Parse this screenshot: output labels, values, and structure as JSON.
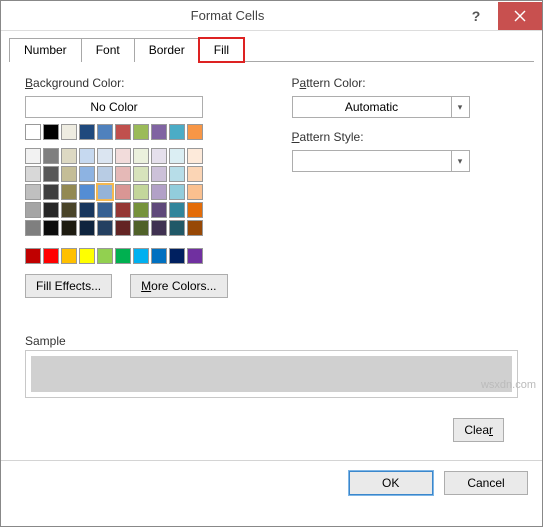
{
  "window": {
    "title": "Format Cells"
  },
  "tabs": {
    "number": "Number",
    "font": "Font",
    "border": "Border",
    "fill": "Fill"
  },
  "fill": {
    "bg_label": "Background Color:",
    "no_color": "No Color",
    "pattern_color_label": "Pattern Color:",
    "pattern_color_value": "Automatic",
    "pattern_style_label": "Pattern Style:",
    "pattern_style_value": "",
    "fill_effects": "Fill Effects...",
    "more_colors": "More Colors...",
    "sample_label": "Sample",
    "clear": "Clear"
  },
  "footer": {
    "ok": "OK",
    "cancel": "Cancel"
  },
  "swatches": {
    "row0": [
      "#ffffff",
      "#000000",
      "#eeece1",
      "#1f497d",
      "#4f81bd",
      "#c0504d",
      "#9bbb59",
      "#8064a2",
      "#4bacc6",
      "#f79646"
    ],
    "row1": [
      "#f2f2f2",
      "#7f7f7f",
      "#ddd9c3",
      "#c6d9f0",
      "#dbe5f1",
      "#f2dcdb",
      "#ebf1dd",
      "#e5e0ec",
      "#dbeef3",
      "#fdeada"
    ],
    "row2": [
      "#d8d8d8",
      "#595959",
      "#c4bd97",
      "#8db3e2",
      "#b8cce4",
      "#e5b9b7",
      "#d7e3bc",
      "#ccc1d9",
      "#b7dde8",
      "#fbd5b5"
    ],
    "row3": [
      "#bfbfbf",
      "#3f3f3f",
      "#938953",
      "#548dd4",
      "#95b3d7",
      "#d99694",
      "#c3d69b",
      "#b2a1c7",
      "#92cddc",
      "#fac08f"
    ],
    "row4": [
      "#a5a5a5",
      "#262626",
      "#494429",
      "#17365d",
      "#366092",
      "#953734",
      "#76923c",
      "#5f497a",
      "#31859b",
      "#e36c09"
    ],
    "row5": [
      "#7f7f7f",
      "#0c0c0c",
      "#1d1b10",
      "#0f243e",
      "#244061",
      "#632423",
      "#4f6128",
      "#3f3151",
      "#205867",
      "#974806"
    ],
    "standard": [
      "#c00000",
      "#ff0000",
      "#ffc000",
      "#ffff00",
      "#92d050",
      "#00b050",
      "#00b0f0",
      "#0070c0",
      "#002060",
      "#7030a0"
    ]
  },
  "watermark": "wsxdn.com"
}
